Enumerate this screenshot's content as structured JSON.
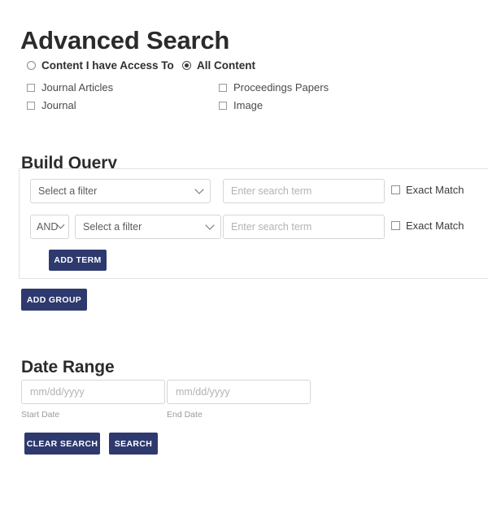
{
  "page": {
    "title": "Advanced Search"
  },
  "scope": {
    "options": [
      {
        "label": "Content I have Access To",
        "selected": false
      },
      {
        "label": "All Content",
        "selected": true
      }
    ]
  },
  "content_types": [
    {
      "label": "Journal Articles",
      "checked": false
    },
    {
      "label": "Journal",
      "checked": false
    },
    {
      "label": "Proceedings Papers",
      "checked": false
    },
    {
      "label": "Image",
      "checked": false
    }
  ],
  "build_query": {
    "heading": "Build Query",
    "rows": [
      {
        "filter_value": "Select a filter",
        "term_placeholder": "Enter search term",
        "term_value": "",
        "exact_match_label": "Exact Match",
        "exact_match_checked": false
      },
      {
        "boolean_value": "AND",
        "filter_value": "Select a filter",
        "term_placeholder": "Enter search term",
        "term_value": "",
        "exact_match_label": "Exact Match",
        "exact_match_checked": false
      }
    ],
    "add_term_label": "ADD TERM",
    "add_group_label": "ADD GROUP"
  },
  "date_range": {
    "heading": "Date Range",
    "start_placeholder": "mm/dd/yyyy",
    "start_value": "",
    "start_label": "Start Date",
    "end_placeholder": "mm/dd/yyyy",
    "end_value": "",
    "end_label": "End Date"
  },
  "actions": {
    "clear_label": "CLEAR SEARCH",
    "search_label": "SEARCH"
  },
  "colors": {
    "button_navy": "#2e3a6e",
    "heading_text": "#2b2b2b",
    "border_gray": "#d6d6d6",
    "group_border": "#e2e2e2",
    "placeholder_gray": "#b3b3b3"
  }
}
